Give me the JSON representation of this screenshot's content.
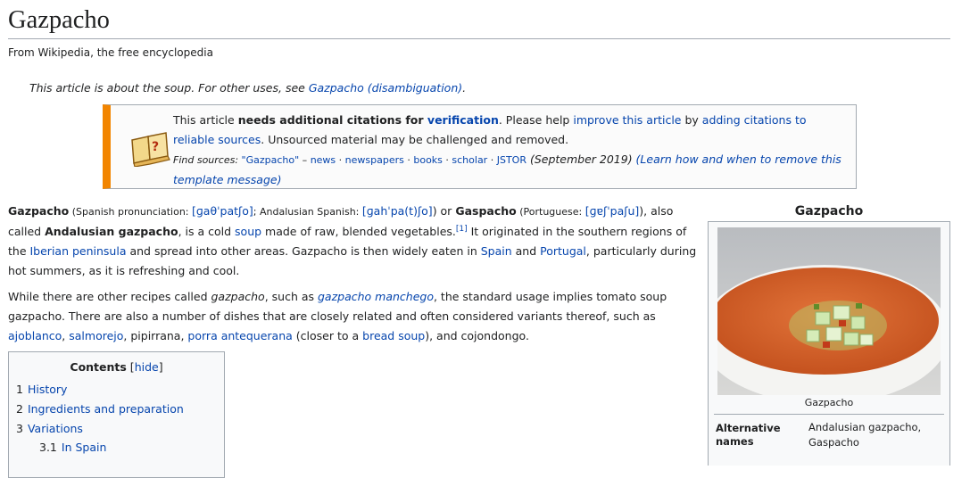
{
  "page": {
    "title": "Gazpacho",
    "tagline": "From Wikipedia, the free encyclopedia"
  },
  "hatnote": {
    "text": "This article is about the soup. For other uses, see ",
    "link": "Gazpacho (disambiguation)",
    "end": "."
  },
  "ambox": {
    "icon": "book-question-icon",
    "t1": "This article ",
    "bold": "needs additional citations for ",
    "verification": "verification",
    "t2": ". Please help ",
    "improve": "improve this article",
    "t3": " by ",
    "adding": "adding citations to reliable sources",
    "t4": ". Unsourced material may be challenged and removed.",
    "find_label": "Find sources: ",
    "find_query": "\"Gazpacho\"",
    "dash": " – ",
    "sources": [
      "news",
      "newspapers",
      "books",
      "scholar",
      "JSTOR"
    ],
    "sep": " · ",
    "date": " (September 2019)",
    "learn": " (Learn how and when to remove this template message)"
  },
  "lead": {
    "p1": {
      "bold1": "Gazpacho",
      "pron1_label": " (Spanish pronunciation: ",
      "pron1": "[ɡaθˈpatʃo]",
      "pron2_label": "; Andalusian Spanish: ",
      "pron2": "[ɡahˈpa(t)ʃo]",
      "t_or": ") or ",
      "bold2": "Gaspacho",
      "pron3_label": " (Portuguese: ",
      "pron3": "[ɡɐʃˈpaʃu]",
      "t_also": "), also called ",
      "bold3": "Andalusian gazpacho",
      "t_cold": ", is a cold ",
      "soup": "soup",
      "t_made": " made of raw, blended vegetables.",
      "ref": "[1]",
      "t_orig": " It originated in the southern regions of the ",
      "iberian": "Iberian peninsula",
      "t_spread": " and spread into other areas. Gazpacho is then widely eaten in ",
      "spain": "Spain",
      "t_and": " and ",
      "portugal": "Portugal",
      "t_end": ", particularly during hot summers, as it is refreshing and cool."
    },
    "p2": {
      "t1": "While there are other recipes called ",
      "gaz_it": "gazpacho",
      "t2": ", such as ",
      "manchego": "gazpacho manchego",
      "t3": ", the standard usage implies tomato soup gazpacho. There are also a number of dishes that are closely related and often considered variants thereof, such as ",
      "ajoblanco": "ajoblanco",
      "c1": ", ",
      "salmorejo": "salmorejo",
      "c2": ", pipirrana, ",
      "porra": "porra antequerana",
      "t4": " (closer to a ",
      "bread": "bread soup",
      "t5": "), and cojondongo."
    }
  },
  "toc": {
    "title": "Contents",
    "hide_open": " [",
    "hide": "hide",
    "hide_close": "]",
    "items": [
      {
        "num": "1",
        "label": "History"
      },
      {
        "num": "2",
        "label": "Ingredients and preparation"
      },
      {
        "num": "3",
        "label": "Variations"
      },
      {
        "num": "3.1",
        "label": "In Spain"
      }
    ]
  },
  "infobox": {
    "title": "Gazpacho",
    "caption": "Gazpacho",
    "alt_label": "Alternative names",
    "alt_value": "Andalusian gazpacho, Gaspacho",
    "colors": {
      "soup": "#d9662a",
      "cucumber": "#c8e6a8",
      "bowl": "#f4f4f2"
    }
  }
}
